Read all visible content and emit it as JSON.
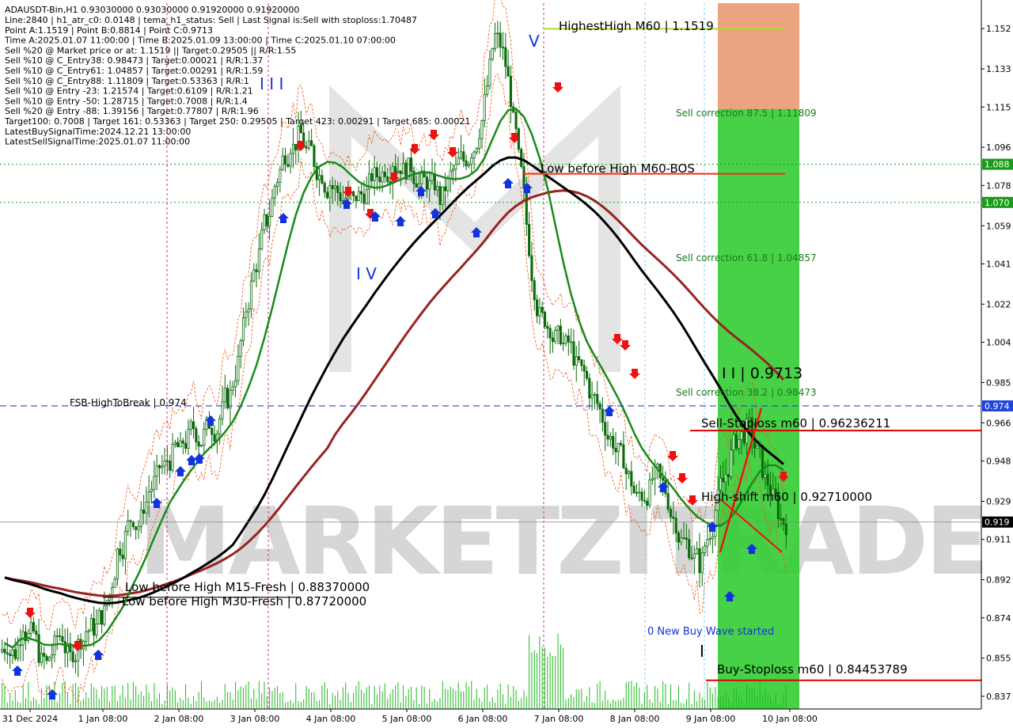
{
  "chart_data": {
    "type": "candlestick",
    "symbol_line": "ADAUSDT-Bin,H1  0.93030000 0.93030000 0.91920000 0.91920000",
    "info_lines": [
      "Line:2840 | h1_atr_c0: 0.0148 | tema_h1_status: Sell | Last Signal is:Sell with stoploss:1.70487",
      "Point A:1.1519 | Point B:0.8814 | Point C:0.9713",
      "Time A:2025.01.07 11:00:00 | Time B:2025.01.09 13:00:00 | Time C:2025.01.10 07:00:00",
      "Sell %20 @ Market price or at: 1.1519 || Target:0.29505 || R/R:1.55",
      "Sell %10 @ C_Entry38: 0.98473 | Target:0.00021 | R/R:1.37",
      "Sell %10 @ C_Entry61: 1.04857 | Target:0.00291 | R/R:1.59",
      "Sell %10 @ C_Entry88: 1.11809 | Target:0.53363 | R/R:1",
      "Sell %10 @ Entry -23: 1.21574 | Target:0.6109 | R/R:1.21",
      "Sell %10 @ Entry -50: 1.28715 | Target:0.7008 | R/R:1.4",
      "Sell %20 @ Entry -88: 1.39156 | Target:0.77807 | R/R:1.96",
      "Target100: 0.7008 | Target 161: 0.53363 | Target 250: 0.29505 | Target 423: 0.00291 | Target 685: 0.00021",
      "LatestBuySignalTime:2024.12.21 13:00:00",
      "LatestSellSignalTime:2025.01.07 11:00:00"
    ],
    "y_ticks": [
      "1.152",
      "1.133",
      "1.115",
      "1.096",
      "1.078",
      "1.059",
      "1.041",
      "1.022",
      "1.004",
      "0.985",
      "0.966",
      "0.948",
      "0.929",
      "0.911",
      "0.892",
      "0.874",
      "0.855",
      "0.837"
    ],
    "x_ticks": [
      "31 Dec 2024",
      "1 Jan 08:00",
      "2 Jan 08:00",
      "3 Jan 08:00",
      "4 Jan 08:00",
      "5 Jan 08:00",
      "6 Jan 08:00",
      "7 Jan 08:00",
      "8 Jan 08:00",
      "9 Jan 08:00",
      "10 Jan 08:00"
    ],
    "price_tags": [
      {
        "value": 1.088,
        "label": "1.088",
        "color": "#1a9c1a"
      },
      {
        "value": 1.07,
        "label": "1.070",
        "color": "#1a9c1a"
      },
      {
        "value": 0.974,
        "label": "0.974",
        "color": "#2244dd"
      },
      {
        "value": 0.9192,
        "label": "0.919",
        "color": "#000000"
      }
    ],
    "annotations": {
      "highest_high": "HighestHigh   M60 | 1.1519",
      "low_before_high_m60": "Low before High   M60-BOS",
      "sell_corr_875": "Sell correction 87.5 | 1.11809",
      "sell_corr_618": "Sell correction 61.8 | 1.04857",
      "sell_corr_382": "Sell correction 38.2 | 0.98473",
      "ii_label": "I I | 0.9713",
      "sell_stoploss": "Sell-Stoploss m60 | 0.96236211",
      "high_shift": "High-shift m60 | 0.92710000",
      "fsb_high": "FSB-HighToBreak | 0.974",
      "lbh_m15": "Low before High    M15-Fresh | 0.88370000",
      "lbh_m30": "Low before High    M30-Fresh | 0.87720000",
      "new_buy_wave": "0 New Buy Wave started",
      "buy_stoploss": "Buy-Stoploss m60 | 0.84453789",
      "wave_v": "V",
      "wave_iii": "I I I",
      "wave_iv": "I V",
      "wave_i": "I"
    },
    "watermark": "MARKETZITRADE",
    "ylim": [
      0.831,
      1.164
    ],
    "closes": [
      0.862,
      0.858,
      0.872,
      0.866,
      0.858,
      0.852,
      0.86,
      0.866,
      0.855,
      0.861,
      0.868,
      0.87,
      0.876,
      0.885,
      0.905,
      0.912,
      0.922,
      0.92,
      0.934,
      0.94,
      0.945,
      0.95,
      0.952,
      0.958,
      0.962,
      0.96,
      0.965,
      0.968,
      0.978,
      0.99,
      1.01,
      1.03,
      1.045,
      1.062,
      1.078,
      1.09,
      1.098,
      1.1,
      1.094,
      1.09,
      1.084,
      1.079,
      1.075,
      1.072,
      1.07,
      1.074,
      1.078,
      1.083,
      1.087,
      1.09,
      1.088,
      1.085,
      1.082,
      1.08,
      1.078,
      1.072,
      1.078,
      1.085,
      1.09,
      1.095,
      1.105,
      1.125,
      1.148,
      1.14,
      1.12,
      1.09,
      1.06,
      1.03,
      1.015,
      1.012,
      1.006,
      1.002,
      0.998,
      0.99,
      0.982,
      0.975,
      0.965,
      0.958,
      0.95,
      0.94,
      0.93,
      0.932,
      0.94,
      0.938,
      0.93,
      0.92,
      0.91,
      0.905,
      0.9,
      0.912,
      0.925,
      0.938,
      0.95,
      0.958,
      0.962,
      0.955,
      0.945,
      0.935,
      0.925,
      0.919
    ]
  },
  "colors": {
    "bull": "#1a9c1a",
    "bear": "#1a9c1a",
    "ema_green": "#1a8a1a",
    "ma_black": "#000000",
    "ma_red": "#9a2222",
    "zone_orange": "#e8946a",
    "zone_green": "#33cc33",
    "dashed_blue": "#2244dd",
    "stoploss_red": "#dd0000"
  }
}
